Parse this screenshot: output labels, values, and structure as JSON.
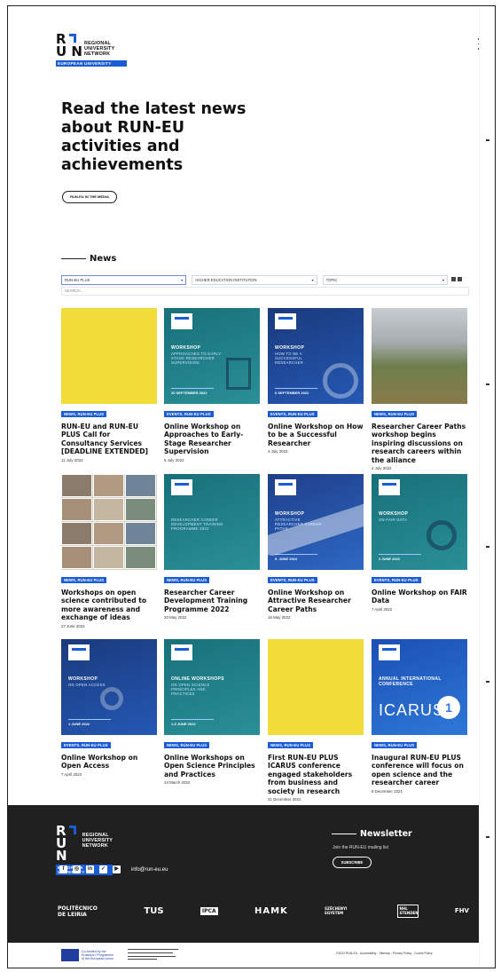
{
  "logo": {
    "letters_top": "R",
    "letters_bottom": "U N",
    "lines": [
      "REGIONAL",
      "UNIVERSITY",
      "NETWORK"
    ],
    "bar": "EUROPEAN UNIVERSITY"
  },
  "hero": {
    "title": "Read the latest news about RUN-EU activities and achievements",
    "button": "RUN-EU IN THE MEDIA"
  },
  "news": {
    "heading": "News",
    "filters": [
      {
        "label": "RUN-EU PLUS"
      },
      {
        "label": "HIGHER EDUCATION INSTITUTION"
      },
      {
        "label": "TOPIC"
      }
    ],
    "search_placeholder": "SEARCH...",
    "cards": [
      {
        "tag": "NEWS, RUN-EU PLUS",
        "title": "RUN-EU and RUN-EU PLUS Call for Consultancy Services [DEADLINE EXTENDED]",
        "date": "11 July 2022",
        "thumb": {
          "style": "yellow"
        }
      },
      {
        "tag": "EVENTS, RUN-EU PLUS",
        "title": "Online Workshop on Approaches to Early-Stage Researcher Supervision",
        "date": "5 July 2022",
        "thumb": {
          "style": "teal",
          "label": "WORKSHOP",
          "sub": "APPROACHES TO EARLY-STAGE RESEARCHER SUPERVISION",
          "date": "20 SEPTEMBER 2022"
        }
      },
      {
        "tag": "EVENTS, RUN-EU PLUS",
        "title": "Online Workshop on How to be a Successful Researcher",
        "date": "4 July 2022",
        "thumb": {
          "style": "navy",
          "label": "WORKSHOP",
          "sub": "HOW TO BE A SUCCESSFUL RESEARCHER",
          "date": "6 SEPTEMBER 2022"
        }
      },
      {
        "tag": "NEWS, RUN-EU PLUS",
        "title": "Researcher Career Paths workshop begins inspiring discussions on research careers within the alliance",
        "date": "4 July 2022",
        "thumb": {
          "style": "nature"
        }
      },
      {
        "tag": "NEWS, RUN-EU PLUS",
        "title": "Workshops on open science contributed to more awareness and exchange of ideas",
        "date": "27 June 2022",
        "thumb": {
          "style": "video"
        }
      },
      {
        "tag": "NEWS, RUN-EU PLUS",
        "title": "Researcher Career Development Training Programme 2022",
        "date": "20 May 2022",
        "thumb": {
          "style": "teal",
          "label": "",
          "sub": "RESEARCHER CAREER DEVELOPMENT TRAINING PROGRAMME 2022",
          "date": ""
        }
      },
      {
        "tag": "EVENTS, RUN-EU PLUS",
        "title": "Online Workshop on Attractive Researcher Career Paths",
        "date": "16 May 2022",
        "thumb": {
          "style": "path",
          "label": "WORKSHOP",
          "sub": "ATTRACTIVE RESEARCHER CAREER PATHS",
          "date": "9. JUNE 2022"
        }
      },
      {
        "tag": "EVENTS, RUN-EU PLUS",
        "title": "Online Workshop on FAIR Data",
        "date": "7 April 2022",
        "thumb": {
          "style": "teal",
          "label": "WORKSHOP",
          "sub": "ON FAIR DATA",
          "date": "2 JUNE 2022"
        }
      },
      {
        "tag": "EVENTS, RUN-EU PLUS",
        "title": "Online Workshop on Open Access",
        "date": "7 April 2022",
        "thumb": {
          "style": "navy",
          "label": "WORKSHOP",
          "sub": "ON OPEN ACCESS",
          "date": "1 JUNE 2022"
        }
      },
      {
        "tag": "NEWS, RUN-EU PLUS",
        "title": "Online Workshops on Open Science Principles and Practices",
        "date": "24 March 2022",
        "thumb": {
          "style": "teal",
          "label": "ONLINE WORKSHOPS",
          "sub": "ON OPEN SCIENCE PRINCIPLES AND PRACTICES",
          "date": "1-3 JUNE 2022"
        }
      },
      {
        "tag": "NEWS, RUN-EU PLUS",
        "title": "First RUN-EU PLUS ICARUS conference engaged stakeholders from business and society in research",
        "date": "21 December 2021",
        "thumb": {
          "style": "yellow"
        }
      },
      {
        "tag": "NEWS, RUN-EU PLUS",
        "title": "Inaugural RUN-EU PLUS conference will focus on open science and the researcher career",
        "date": "9 December 2021",
        "thumb": {
          "style": "conf",
          "label": "ANNUAL INTERNATIONAL CONFERENCE",
          "sub": "",
          "date": "",
          "big": "ICARUS",
          "num": "1"
        }
      }
    ]
  },
  "footer": {
    "email": "info@run-eu.eu",
    "socials": [
      {
        "icon": "facebook-icon",
        "glyph": "f"
      },
      {
        "icon": "instagram-icon",
        "glyph": "◎"
      },
      {
        "icon": "linkedin-icon",
        "glyph": "in"
      },
      {
        "icon": "twitter-icon",
        "glyph": "✓"
      },
      {
        "icon": "youtube-icon",
        "glyph": "▶"
      }
    ],
    "newsletter": {
      "heading": "Newsletter",
      "text": "Join the RUN-EU mailing list",
      "button": "SUBSCRIBE"
    },
    "partners": [
      "POLITÉCNICO DE LEIRIA",
      "TUS",
      "IPCA",
      "HAMK",
      "SZÉCHENYI EGYETEM",
      "NHL STENDEN",
      "FHV"
    ],
    "eu_text": "Co-funded by the Erasmus+ Programme of the European Union",
    "legal": "©2022 RUN-EU - Accessibility - Sitemap - Privacy Policy - Cookie Policy"
  },
  "colors": {
    "accent": "#1a5bd6",
    "footer_bg": "#202020",
    "yellow": "#f2dc3a"
  }
}
